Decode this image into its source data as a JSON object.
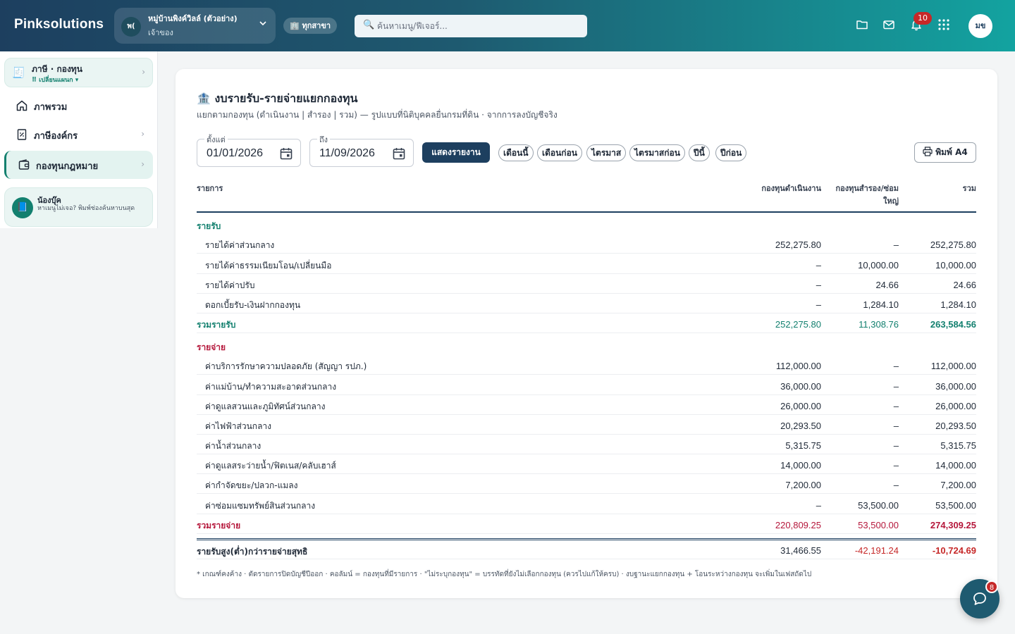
{
  "app": {
    "brand": "Pinksolutions",
    "village": {
      "avatar": "พ(",
      "name": "หมู่บ้านพิงค์วิลล์ (ตัวอย่าง)",
      "role": "เจ้าของ"
    },
    "branch_label": "🏢 ทุกสาขา",
    "search_placeholder": "ค้นหาเมนู/ฟีเจอร์...",
    "notification_count": "10",
    "user_initials": "มข",
    "chat_badge": "8"
  },
  "sidebar": {
    "module": {
      "title": "ภาษี · กองทุน",
      "subtitle": "⠿ เปลี่ยนแผนก ▾"
    },
    "items": [
      {
        "label": "ภาพรวม"
      },
      {
        "label": "ภาษีองค์กร"
      },
      {
        "label": "กองทุนกฎหมาย"
      }
    ],
    "helper": {
      "title": "น้องบุ๊ค",
      "subtitle": "หาเมนูไม่เจอ? พิมพ์ช่องค้นหาบนสุด"
    }
  },
  "report": {
    "title": "งบรายรับ-รายจ่ายแยกกองทุน",
    "subtitle": "แยกตามกองทุน (ดำเนินงาน | สำรอง | รวม) — รูปแบบที่นิติบุคคลยื่นกรมที่ดิน · จากการลงบัญชีจริง",
    "from_label": "ตั้งแต่",
    "from_value": "01/01/2026",
    "to_label": "ถึง",
    "to_value": "11/09/2026",
    "show_button": "แสดงรายงาน",
    "quick_ranges": [
      "เดือนนี้",
      "เดือนก่อน",
      "ไตรมาส",
      "ไตรมาสก่อน",
      "ปีนี้",
      "ปีก่อน"
    ],
    "print_button": "พิมพ์ A4",
    "columns": {
      "item": "รายการ",
      "operating": "กองทุนดำเนินงาน",
      "reserve_line1": "กองทุนสำรอง/ซ่อม",
      "reserve_line2": "ใหญ่",
      "total": "รวม"
    },
    "income": {
      "heading": "รายรับ",
      "rows": [
        {
          "label": "รายได้ค่าส่วนกลาง",
          "operating": "252,275.80",
          "reserve": "–",
          "total": "252,275.80"
        },
        {
          "label": "รายได้ค่าธรรมเนียมโอน/เปลี่ยนมือ",
          "operating": "–",
          "reserve": "10,000.00",
          "total": "10,000.00"
        },
        {
          "label": "รายได้ค่าปรับ",
          "operating": "–",
          "reserve": "24.66",
          "total": "24.66"
        },
        {
          "label": "ดอกเบี้ยรับ-เงินฝากกองทุน",
          "operating": "–",
          "reserve": "1,284.10",
          "total": "1,284.10"
        }
      ],
      "total": {
        "label": "รวมรายรับ",
        "operating": "252,275.80",
        "reserve": "11,308.76",
        "total": "263,584.56"
      }
    },
    "expense": {
      "heading": "รายจ่าย",
      "rows": [
        {
          "label": "ค่าบริการรักษาความปลอดภัย (สัญญา รปภ.)",
          "operating": "112,000.00",
          "reserve": "–",
          "total": "112,000.00"
        },
        {
          "label": "ค่าแม่บ้าน/ทำความสะอาดส่วนกลาง",
          "operating": "36,000.00",
          "reserve": "–",
          "total": "36,000.00"
        },
        {
          "label": "ค่าดูแลสวนและภูมิทัศน์ส่วนกลาง",
          "operating": "26,000.00",
          "reserve": "–",
          "total": "26,000.00"
        },
        {
          "label": "ค่าไฟฟ้าส่วนกลาง",
          "operating": "20,293.50",
          "reserve": "–",
          "total": "20,293.50"
        },
        {
          "label": "ค่าน้ำส่วนกลาง",
          "operating": "5,315.75",
          "reserve": "–",
          "total": "5,315.75"
        },
        {
          "label": "ค่าดูแลสระว่ายน้ำ/ฟิตเนส/คลับเฮาส์",
          "operating": "14,000.00",
          "reserve": "–",
          "total": "14,000.00"
        },
        {
          "label": "ค่ากำจัดขยะ/ปลวก-แมลง",
          "operating": "7,200.00",
          "reserve": "–",
          "total": "7,200.00"
        },
        {
          "label": "ค่าซ่อมแซมทรัพย์สินส่วนกลาง",
          "operating": "–",
          "reserve": "53,500.00",
          "total": "53,500.00"
        }
      ],
      "total": {
        "label": "รวมรายจ่าย",
        "operating": "220,809.25",
        "reserve": "53,500.00",
        "total": "274,309.25"
      }
    },
    "net": {
      "label": "รายรับสูง(ต่ำ)กว่ารายจ่ายสุทธิ",
      "operating": "31,466.55",
      "reserve": "-42,191.24",
      "total": "-10,724.69"
    },
    "footnote": "* เกณฑ์คงค้าง · ตัดรายการปิดบัญชีปีออก · คอลัมน์ = กองทุนที่มีรายการ · \"ไม่ระบุกองทุน\" = บรรทัดที่ยังไม่เลือกกองทุน (ควรไปแก้ให้ครบ) · งบฐานะแยกกองทุน + โอนระหว่างกองทุน จะเพิ่มในเฟสถัดไป"
  },
  "colors": {
    "income": "#13806f",
    "expense": "#b5173b",
    "negative": "#c62828",
    "primary": "#1d3f5f"
  }
}
